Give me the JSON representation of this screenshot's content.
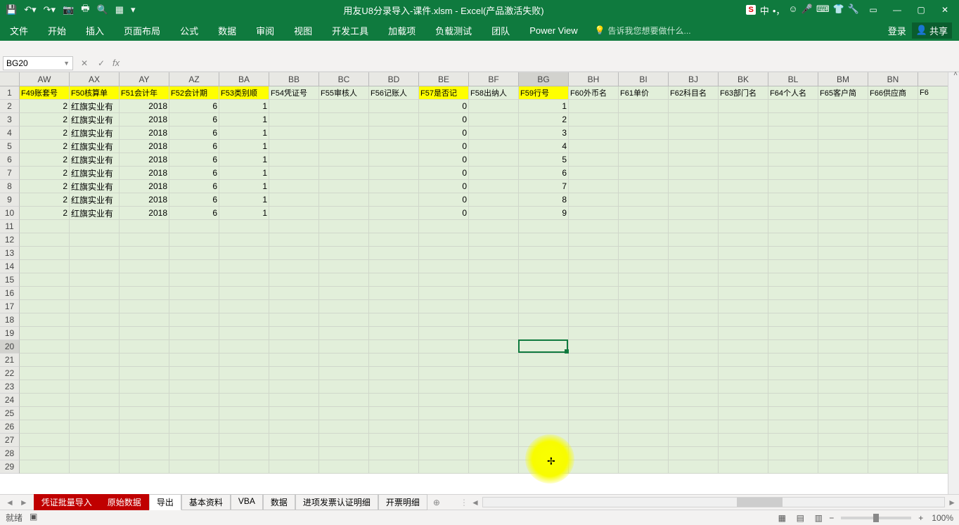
{
  "title": "用友U8分录导入-课件.xlsm - Excel(产品激活失败)",
  "namebox": "BG20",
  "qat_icons": [
    "save-icon",
    "undo-icon",
    "redo-icon",
    "camera-icon",
    "print-icon",
    "print-preview-icon",
    "spellcheck-icon"
  ],
  "ribbon_tabs": [
    "文件",
    "开始",
    "插入",
    "页面布局",
    "公式",
    "数据",
    "审阅",
    "视图",
    "开发工具",
    "加载项",
    "负载测试",
    "团队",
    "Power View"
  ],
  "tellme_placeholder": "告诉我您想要做什么...",
  "login": "登录",
  "share": "共享",
  "ime": "中",
  "cols": [
    "AW",
    "AX",
    "AY",
    "AZ",
    "BA",
    "BB",
    "BC",
    "BD",
    "BE",
    "BF",
    "BG",
    "BH",
    "BI",
    "BJ",
    "BK",
    "BL",
    "BM",
    "BN"
  ],
  "selected_col": "BG",
  "headers": [
    "F49账套号",
    "F50核算单",
    "F51会计年",
    "F52会计期",
    "F53类别顺",
    "F54凭证号",
    "F55审核人",
    "F56记账人",
    "F57是否记",
    "F58出纳人",
    "F59行号",
    "F60外币名",
    "F61单价",
    "F62科目名",
    "F63部门名",
    "F64个人名",
    "F65客户简",
    "F66供应商",
    "F6"
  ],
  "highlighted_headers": [
    0,
    1,
    2,
    3,
    4,
    8,
    10
  ],
  "last_col_partial": "F6",
  "data_rows": [
    {
      "AW": "2",
      "AX": "红旗实业有",
      "AY": "2018",
      "AZ": "6",
      "BA": "1",
      "BE": "0",
      "BG": "1"
    },
    {
      "AW": "2",
      "AX": "红旗实业有",
      "AY": "2018",
      "AZ": "6",
      "BA": "1",
      "BE": "0",
      "BG": "2"
    },
    {
      "AW": "2",
      "AX": "红旗实业有",
      "AY": "2018",
      "AZ": "6",
      "BA": "1",
      "BE": "0",
      "BG": "3"
    },
    {
      "AW": "2",
      "AX": "红旗实业有",
      "AY": "2018",
      "AZ": "6",
      "BA": "1",
      "BE": "0",
      "BG": "4"
    },
    {
      "AW": "2",
      "AX": "红旗实业有",
      "AY": "2018",
      "AZ": "6",
      "BA": "1",
      "BE": "0",
      "BG": "5"
    },
    {
      "AW": "2",
      "AX": "红旗实业有",
      "AY": "2018",
      "AZ": "6",
      "BA": "1",
      "BE": "0",
      "BG": "6"
    },
    {
      "AW": "2",
      "AX": "红旗实业有",
      "AY": "2018",
      "AZ": "6",
      "BA": "1",
      "BE": "0",
      "BG": "7"
    },
    {
      "AW": "2",
      "AX": "红旗实业有",
      "AY": "2018",
      "AZ": "6",
      "BA": "1",
      "BE": "0",
      "BG": "8"
    },
    {
      "AW": "2",
      "AX": "红旗实业有",
      "AY": "2018",
      "AZ": "6",
      "BA": "1",
      "BE": "0",
      "BG": "9"
    }
  ],
  "row_count": 29,
  "selected_row": 20,
  "sheet_tabs": [
    {
      "label": "凭证批量导入",
      "red": true
    },
    {
      "label": "原始数据",
      "red": true
    },
    {
      "label": "导出",
      "active": true
    },
    {
      "label": "基本资料"
    },
    {
      "label": "VBA"
    },
    {
      "label": "数据"
    },
    {
      "label": "进项发票认证明细"
    },
    {
      "label": "开票明细"
    }
  ],
  "status": "就绪",
  "macro_icon": "宏",
  "zoom": "100%",
  "zoom_minus": "−",
  "zoom_plus": "+"
}
